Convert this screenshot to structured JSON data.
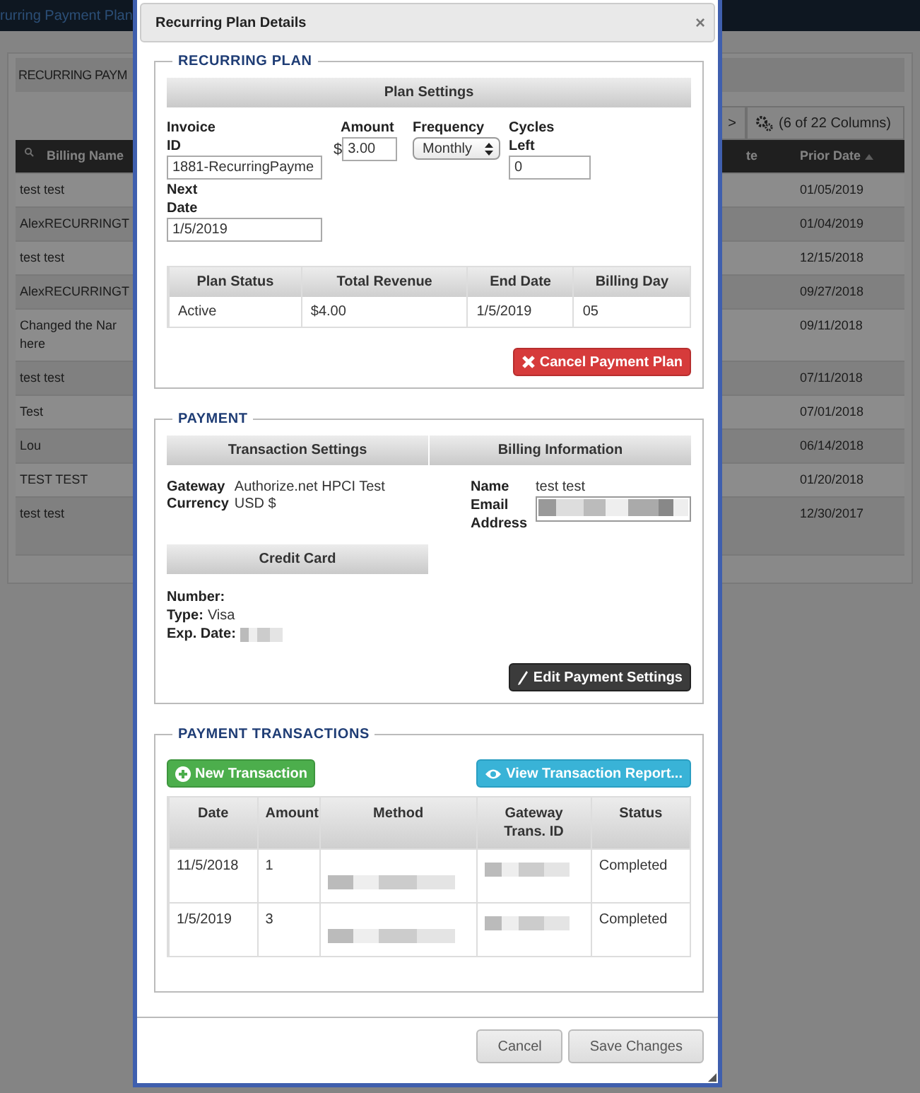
{
  "background": {
    "breadcrumb": "rurring Payment Plan",
    "panel_title": "RECURRING PAYM",
    "pager_button": ">",
    "columns_button": "(6 of 22 Columns)",
    "columns": [
      {
        "label": "Billing Name"
      },
      {
        "label": "te"
      },
      {
        "label": "Prior Date"
      }
    ],
    "rows": [
      {
        "billing_name": "test test",
        "prior_date": "01/05/2019"
      },
      {
        "billing_name": "AlexRECURRINGT",
        "prior_date": "01/04/2019"
      },
      {
        "billing_name": "test test",
        "prior_date": "12/15/2018"
      },
      {
        "billing_name": "AlexRECURRINGT",
        "prior_date": "09/27/2018"
      },
      {
        "billing_name": "Changed the Nar here",
        "prior_date": "09/11/2018"
      },
      {
        "billing_name": "test test",
        "prior_date": "07/11/2018"
      },
      {
        "billing_name": "Test",
        "prior_date": "07/01/2018"
      },
      {
        "billing_name": "Lou",
        "prior_date": "06/14/2018"
      },
      {
        "billing_name": "TEST TEST",
        "prior_date": "01/20/2018"
      },
      {
        "billing_name": "test test",
        "prior_date": "12/30/2017"
      }
    ]
  },
  "modal": {
    "title": "Recurring Plan Details",
    "close": "×",
    "recurring_plan": {
      "legend": "RECURRING PLAN",
      "settings_header": "Plan Settings",
      "invoice_id": {
        "label": "Invoice ID",
        "value": "1881-RecurringPayme"
      },
      "amount": {
        "label": "Amount",
        "prefix": "$",
        "value": "3.00"
      },
      "frequency": {
        "label": "Frequency",
        "value": "Monthly"
      },
      "cycles_left": {
        "label": "Cycles Left",
        "value": "0"
      },
      "next_date": {
        "label": "Next Date",
        "value": "1/5/2019"
      },
      "status_table": {
        "columns": [
          "Plan Status",
          "Total Revenue",
          "End Date",
          "Billing Day"
        ],
        "row": [
          "Active",
          "$4.00",
          "1/5/2019",
          "05"
        ]
      },
      "cancel_button": "Cancel Payment Plan"
    },
    "payment": {
      "legend": "PAYMENT",
      "transaction_header": "Transaction Settings",
      "billing_header": "Billing Information",
      "gateway": {
        "label": "Gateway",
        "value": "Authorize.net HPCI Test"
      },
      "currency": {
        "label": "Currency",
        "value": "USD $"
      },
      "name": {
        "label": "Name",
        "value": "test test"
      },
      "email": {
        "label": "Email Address"
      },
      "credit_card_header": "Credit Card",
      "number": {
        "label": "Number:"
      },
      "type": {
        "label": "Type:",
        "value": "Visa"
      },
      "exp_date": {
        "label": "Exp. Date:"
      },
      "edit_button": "Edit Payment Settings"
    },
    "transactions": {
      "legend": "PAYMENT TRANSACTIONS",
      "new_button": "New Transaction",
      "report_button": "View Transaction Report...",
      "columns": [
        "Date",
        "Amount",
        "Method",
        "Gateway Trans. ID",
        "Status"
      ],
      "rows": [
        {
          "date": "11/5/2018",
          "amount": "1",
          "status": "Completed"
        },
        {
          "date": "1/5/2019",
          "amount": "3",
          "status": "Completed"
        }
      ]
    },
    "footer": {
      "cancel": "Cancel",
      "save": "Save Changes"
    }
  }
}
